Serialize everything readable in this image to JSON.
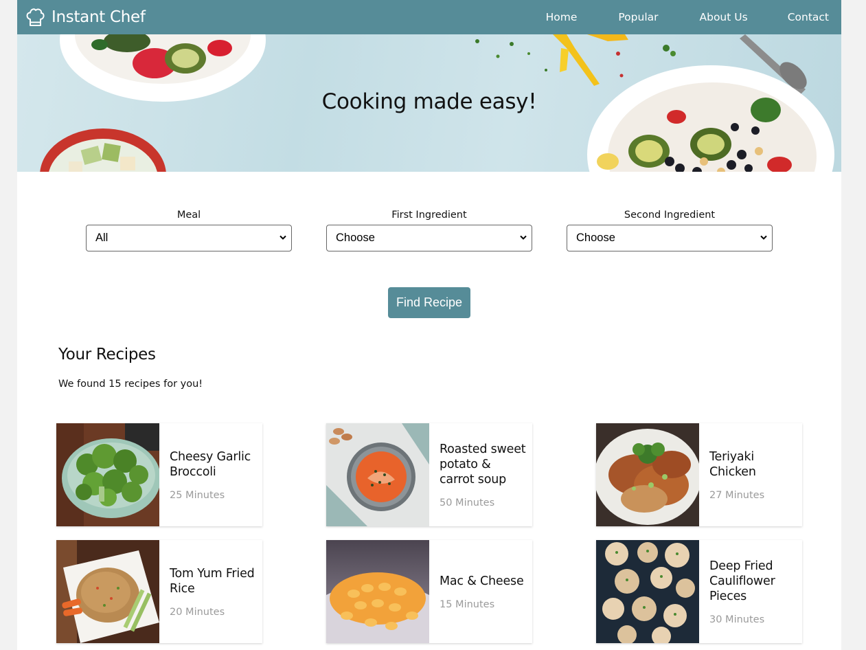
{
  "brand": {
    "name": "Instant Chef",
    "icon": "chef-hat-icon"
  },
  "nav": {
    "home": "Home",
    "popular": "Popular",
    "about": "About Us",
    "contact": "Contact"
  },
  "hero": {
    "title": "Cooking made easy!"
  },
  "filters": {
    "meal": {
      "label": "Meal",
      "value": "All"
    },
    "first_ingredient": {
      "label": "First Ingredient",
      "value": "Choose"
    },
    "second_ingredient": {
      "label": "Second Ingredient",
      "value": "Choose"
    }
  },
  "find_button": "Find Recipe",
  "results": {
    "title": "Your Recipes",
    "count_text": "We found 15 recipes for you!"
  },
  "recipes": [
    {
      "name": "Cheesy Garlic Broccoli",
      "time": "25 Minutes",
      "image": "broccoli-bowl"
    },
    {
      "name": "Roasted sweet potato & carrot soup",
      "time": "50 Minutes",
      "image": "soup-bowl"
    },
    {
      "name": "Teriyaki Chicken",
      "time": "27 Minutes",
      "image": "teriyaki-plate"
    },
    {
      "name": "Tom Yum Fried Rice",
      "time": "20 Minutes",
      "image": "fried-rice-plate"
    },
    {
      "name": "Mac & Cheese",
      "time": "15 Minutes",
      "image": "macaroni-bowl"
    },
    {
      "name": "Deep Fried Cauliflower Pieces",
      "time": "30 Minutes",
      "image": "cauliflower-tray"
    }
  ],
  "colors": {
    "accent": "#568c98",
    "muted_text": "#9a9a9a",
    "page_bg": "#f2f2f2"
  }
}
